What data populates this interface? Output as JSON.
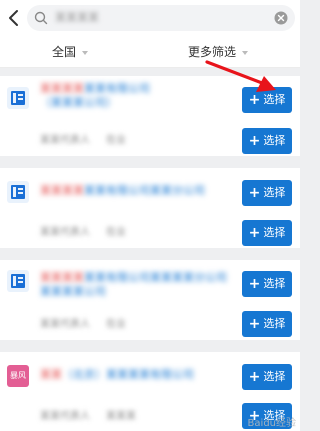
{
  "search": {
    "query": "某某某某"
  },
  "filters": {
    "region_label": "全国",
    "more_label": "更多筛选"
  },
  "results": [
    {
      "logo_text": "",
      "name_red": "某某某某",
      "name_blue": "某某有限公司",
      "sub": "（某某某公司）",
      "meta": [
        "某某代表人",
        "在业"
      ],
      "select_label": "选择"
    },
    {
      "logo_text": "",
      "name_red": "某某某某",
      "name_blue": "某某有限公司某某分公司",
      "sub": "",
      "meta": [
        "某某代表人",
        "在业"
      ],
      "select_label": "选择"
    },
    {
      "logo_text": "",
      "name_red": "某某某某",
      "name_blue": "某某有限公司某某某某分公司",
      "sub": "某某某某公司",
      "meta": [
        "某某代表人",
        "在业"
      ],
      "select_label": "选择"
    },
    {
      "logo_text": "暴风",
      "name_red": "某某",
      "name_blue": "（北京）某某某某有限公司",
      "sub": "",
      "meta": [
        "某某代表人",
        "某某某"
      ],
      "select_label": "选择"
    }
  ],
  "watermark": "Baidu经验"
}
